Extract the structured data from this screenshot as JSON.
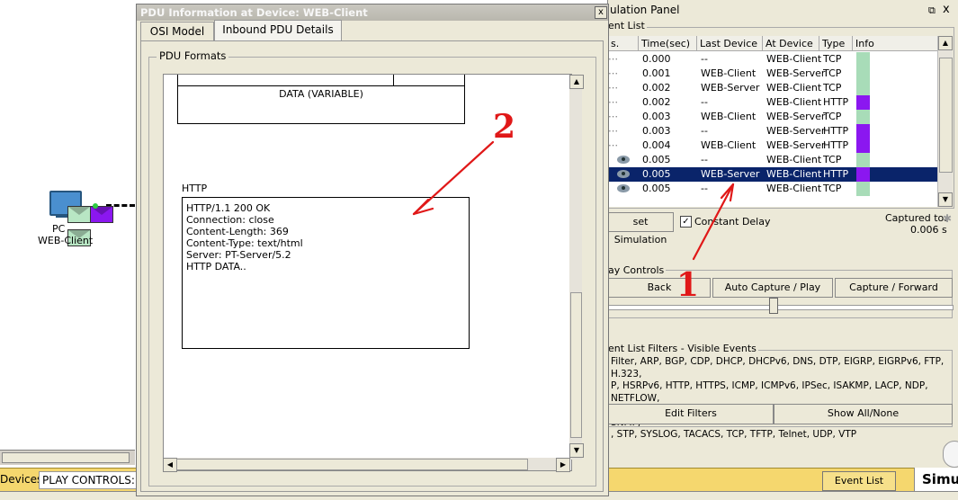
{
  "workspace": {
    "pc_label": "PC",
    "pc_name": "WEB-Client"
  },
  "status_bar": {
    "devices": "Devices",
    "play_controls": "PLAY CONTROLS:"
  },
  "pdu_dialog": {
    "title": "PDU Information at Device: WEB-Client",
    "close": "x",
    "tabs": [
      "OSI Model",
      "Inbound PDU Details"
    ],
    "active_tab": "Inbound PDU Details",
    "formats_legend": "PDU Formats",
    "data_field": "DATA (VARIABLE)",
    "http_label": "HTTP",
    "http_lines": [
      "HTTP/1.1 200 OK",
      "Connection: close",
      "Content-Length: 369",
      "Content-Type: text/html",
      "Server: PT-Server/5.2",
      "HTTP DATA.."
    ]
  },
  "sim_panel": {
    "title": "ulation Panel",
    "restore": "⧉",
    "close": "x",
    "event_list_legend": "ent List",
    "columns": [
      "s.",
      "Time(sec)",
      "Last Device",
      "At Device",
      "Type",
      "Info"
    ],
    "events": [
      {
        "time": "0.000",
        "last": "--",
        "at": "WEB-Client",
        "type": "TCP",
        "info_color": "#a8dcb8",
        "eye": false,
        "selected": false
      },
      {
        "time": "0.001",
        "last": "WEB-Client",
        "at": "WEB-Server",
        "type": "TCP",
        "info_color": "#a8dcb8",
        "eye": false,
        "selected": false
      },
      {
        "time": "0.002",
        "last": "WEB-Server",
        "at": "WEB-Client",
        "type": "TCP",
        "info_color": "#a8dcb8",
        "eye": false,
        "selected": false
      },
      {
        "time": "0.002",
        "last": "--",
        "at": "WEB-Client",
        "type": "HTTP",
        "info_color": "#8b17f0",
        "eye": false,
        "selected": false
      },
      {
        "time": "0.003",
        "last": "WEB-Client",
        "at": "WEB-Server",
        "type": "TCP",
        "info_color": "#a8dcb8",
        "eye": false,
        "selected": false
      },
      {
        "time": "0.003",
        "last": "--",
        "at": "WEB-Server",
        "type": "HTTP",
        "info_color": "#8b17f0",
        "eye": false,
        "selected": false
      },
      {
        "time": "0.004",
        "last": "WEB-Client",
        "at": "WEB-Server",
        "type": "HTTP",
        "info_color": "#8b17f0",
        "eye": false,
        "selected": false
      },
      {
        "time": "0.005",
        "last": "--",
        "at": "WEB-Client",
        "type": "TCP",
        "info_color": "#a8dcb8",
        "eye": true,
        "selected": false
      },
      {
        "time": "0.005",
        "last": "WEB-Server",
        "at": "WEB-Client",
        "type": "HTTP",
        "info_color": "#8b17f0",
        "eye": true,
        "selected": true
      },
      {
        "time": "0.005",
        "last": "--",
        "at": "WEB-Client",
        "type": "TCP",
        "info_color": "#a8dcb8",
        "eye": true,
        "selected": false
      }
    ],
    "reset_simulation": "set Simulation",
    "constant_delay": "Constant Delay",
    "constant_delay_checked": true,
    "captured_to_label": "Captured to:",
    "captured_to_value": "0.006 s",
    "play_controls_legend": "ay Controls",
    "back": "Back",
    "auto_capture": "Auto Capture / Play",
    "capture_forward": "Capture / Forward",
    "filters_legend": "ent List Filters - Visible Events",
    "filters_lines": [
      "Filter, ARP, BGP, CDP, DHCP, DHCPv6, DNS, DTP, EIGRP, EIGRPv6, FTP, H.323,",
      "P, HSRPv6, HTTP, HTTPS, ICMP, ICMPv6, IPSec, ISAKMP, LACP, NDP, NETFLOW,",
      "OSPF, OSPFv6, PAgP, POP3, RADIUS, RIP, RIPng, RTP, SCCP, SMTP, SNMP,",
      ", STP, SYSLOG, TACACS, TCP, TFTP, Telnet, UDP, VTP"
    ],
    "edit_filters": "Edit Filters",
    "show_all_none": "Show All/None",
    "event_list_tab": "Event List",
    "simulation_tab": "Simu"
  },
  "annotations": {
    "one": "1",
    "two": "2",
    "color": "#e01818"
  }
}
